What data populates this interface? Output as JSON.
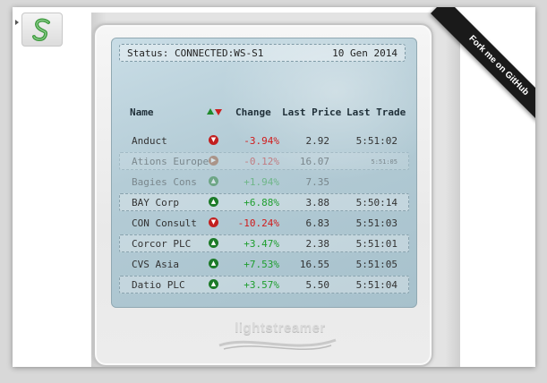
{
  "app": {
    "logo_letter": "S"
  },
  "status": {
    "text": "Status: CONNECTED:WS-S1",
    "date": "10 Gen 2014"
  },
  "headers": {
    "name": "Name",
    "change": "Change",
    "last_price": "Last Price",
    "last_trade": "Last Trade"
  },
  "rows": [
    {
      "name": "Anduct",
      "trend": "down",
      "change": "-3.94%",
      "price": "2.92",
      "trade": "5:51:02",
      "alt": false,
      "faded": false,
      "small_trade": false
    },
    {
      "name": "Ations Europe",
      "trend": "neutral",
      "change": "-0.12%",
      "price": "16.07",
      "trade": "5:51:05",
      "alt": true,
      "faded": true,
      "small_trade": true
    },
    {
      "name": "Bagies Cons",
      "trend": "up",
      "change": "+1.94%",
      "price": "7.35",
      "trade": "",
      "alt": false,
      "faded": true,
      "small_trade": false
    },
    {
      "name": "BAY Corp",
      "trend": "up",
      "change": "+6.88%",
      "price": "3.88",
      "trade": "5:50:14",
      "alt": true,
      "faded": false,
      "small_trade": false
    },
    {
      "name": "CON Consult",
      "trend": "down",
      "change": "-10.24%",
      "price": "6.83",
      "trade": "5:51:03",
      "alt": false,
      "faded": false,
      "small_trade": false
    },
    {
      "name": "Corcor PLC",
      "trend": "up",
      "change": "+3.47%",
      "price": "2.38",
      "trade": "5:51:01",
      "alt": true,
      "faded": false,
      "small_trade": false
    },
    {
      "name": "CVS Asia",
      "trend": "up",
      "change": "+7.53%",
      "price": "16.55",
      "trade": "5:51:05",
      "alt": false,
      "faded": false,
      "small_trade": false
    },
    {
      "name": "Datio PLC",
      "trend": "up",
      "change": "+3.57%",
      "price": "5.50",
      "trade": "5:51:04",
      "alt": true,
      "faded": false,
      "small_trade": false
    }
  ],
  "brand": {
    "text": "lightstreamer"
  },
  "ribbon": {
    "text": "Fork me on GitHub"
  },
  "colors": {
    "positive": "#1e9e2e",
    "negative": "#d11a1a",
    "screen": "#b4ccd6"
  },
  "icons": {
    "up": "arrow-up-circle-icon",
    "down": "arrow-down-circle-icon",
    "neutral": "arrow-right-circle-icon"
  }
}
